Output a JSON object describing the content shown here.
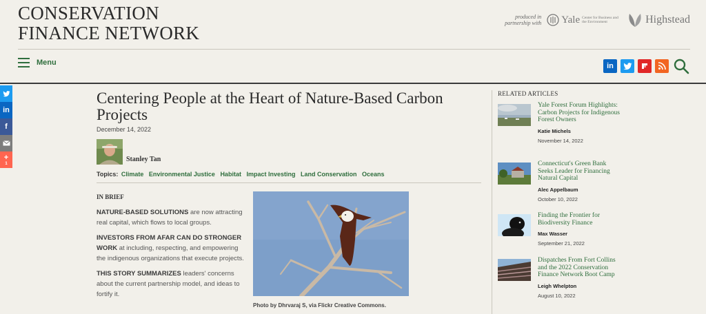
{
  "header": {
    "logo_line1": "CONSERVATION",
    "logo_line2": "FINANCE NETWORK",
    "produced_in": "produced in partnership with",
    "yale_name": "Yale",
    "yale_sub": "Center for Business and the Environment",
    "highstead_name": "Highstead"
  },
  "nav": {
    "menu_label": "Menu",
    "social": [
      {
        "name": "linkedin",
        "glyph": "in",
        "color": "#0a66c2"
      },
      {
        "name": "twitter",
        "glyph": "t",
        "color": "#1d9bf0"
      },
      {
        "name": "flipboard",
        "glyph": "f",
        "color": "#e12828"
      },
      {
        "name": "rss",
        "glyph": "rss",
        "color": "#f26522"
      }
    ]
  },
  "share_bar": {
    "buttons": [
      {
        "name": "twitter",
        "glyph": "t",
        "color": "#1d9bf0"
      },
      {
        "name": "linkedin",
        "glyph": "in",
        "color": "#0a66c2"
      },
      {
        "name": "facebook",
        "glyph": "f",
        "color": "#3b5998"
      },
      {
        "name": "email",
        "glyph": "✉",
        "color": "#7d7d7d"
      },
      {
        "name": "more",
        "glyph": "+",
        "color": "#ff6550"
      }
    ],
    "more_count": "1"
  },
  "article": {
    "title": "Centering People at the Heart of Nature-Based Carbon Projects",
    "date": "December 14, 2022",
    "author": "Stanley Tan",
    "topics_label": "Topics:",
    "topics": [
      "Climate",
      "Environmental Justice",
      "Habitat",
      "Impact Investing",
      "Land Conservation",
      "Oceans"
    ]
  },
  "brief": {
    "heading": "IN BRIEF",
    "items": [
      {
        "lead": "NATURE-BASED SOLUTIONS",
        "rest": " are now attracting real capital, which flows to local groups."
      },
      {
        "lead": "INVESTORS FROM AFAR CAN DO STRONGER WORK",
        "rest": " at including, respecting, and empowering the indigenous organizations that execute projects."
      },
      {
        "lead": "THIS STORY SUMMARIZES",
        "rest": " leaders' concerns about the current partnership model, and ideas to fortify it."
      }
    ]
  },
  "hero": {
    "caption": "Photo by Dhrvaraj S, via Flickr Creative Commons."
  },
  "related": {
    "heading": "RELATED ARTICLES",
    "items": [
      {
        "title": "Yale Forest Forum Highlights: Carbon Projects for Indigenous Forest Owners",
        "author": "Katie Michels",
        "date": "November 14, 2022"
      },
      {
        "title": "Connecticut's Green Bank Seeks Leader for Financing Natural Capital",
        "author": "Alec Appelbaum",
        "date": "October 10, 2022"
      },
      {
        "title": "Finding the Frontier for Biodiversity Finance",
        "author": "Max Wasser",
        "date": "September 21, 2022"
      },
      {
        "title": "Dispatches From Fort Collins and the 2022 Conservation Finance Network Boot Camp",
        "author": "Leigh Whelpton",
        "date": "August 10, 2022"
      }
    ]
  }
}
